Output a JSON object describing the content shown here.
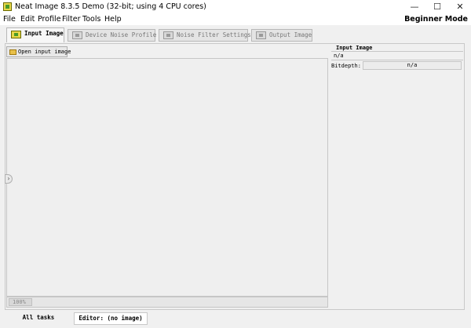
{
  "window": {
    "title": "Neat Image 8.3.5 Demo (32-bit; using 4 CPU cores)",
    "min_glyph": "—",
    "max_glyph": "☐",
    "close_glyph": "✕"
  },
  "menu": {
    "items": [
      "File",
      "Edit",
      "Profile",
      "Filter",
      "Tools",
      "Help"
    ],
    "mode": "Beginner Mode"
  },
  "tabs": [
    {
      "label": "Input Image",
      "icon": "input-image-icon",
      "active": true
    },
    {
      "label": "Device Noise Profile",
      "icon": "noise-profile-icon",
      "active": false
    },
    {
      "label": "Noise Filter Settings",
      "icon": "filter-settings-icon",
      "active": false
    },
    {
      "label": "Output Image",
      "icon": "output-image-icon",
      "active": false
    }
  ],
  "toolbar": {
    "open_label": "Open input image",
    "open_icon": "folder-icon"
  },
  "canvas": {
    "collapse_glyph": "›",
    "zoom": "100%"
  },
  "panel": {
    "title": "Input Image",
    "filename": "n/a",
    "bitdepth_label": "Bitdepth:",
    "bitdepth_value": "n/a"
  },
  "bottom_tabs": {
    "all_tasks": "All tasks",
    "editor": "Editor: (no image)"
  },
  "colors": {
    "window_bg": "#f0f0f0",
    "icon_accent": "#e8d84a"
  }
}
